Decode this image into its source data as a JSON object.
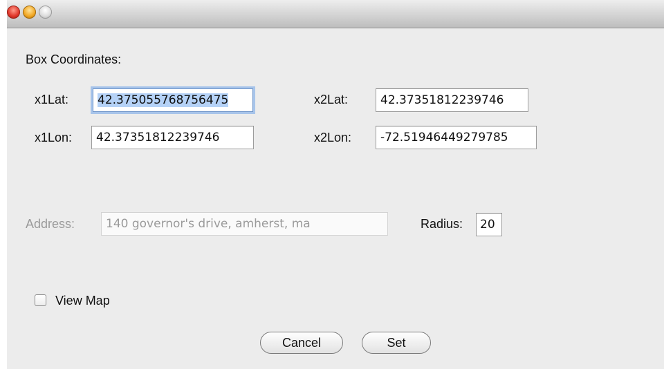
{
  "window": {
    "controls": [
      "close-button",
      "minimize-button",
      "zoom-button"
    ]
  },
  "box_coordinates": {
    "heading": "Box Coordinates:",
    "x1lat_label": "x1Lat:",
    "x1lat_value": "42.375055768756475",
    "x2lat_label": "x2Lat:",
    "x2lat_value": "42.37351812239746",
    "x1lon_label": "x1Lon:",
    "x1lon_value": "42.37351812239746",
    "x2lon_label": "x2Lon:",
    "x2lon_value": "-72.51946449279785"
  },
  "address": {
    "label": "Address:",
    "value": "140 governor's drive, amherst, ma",
    "radius_label": "Radius:",
    "radius_value": "20"
  },
  "options": {
    "view_map_label": "View Map",
    "view_map_checked": false
  },
  "buttons": {
    "cancel": "Cancel",
    "set": "Set"
  }
}
